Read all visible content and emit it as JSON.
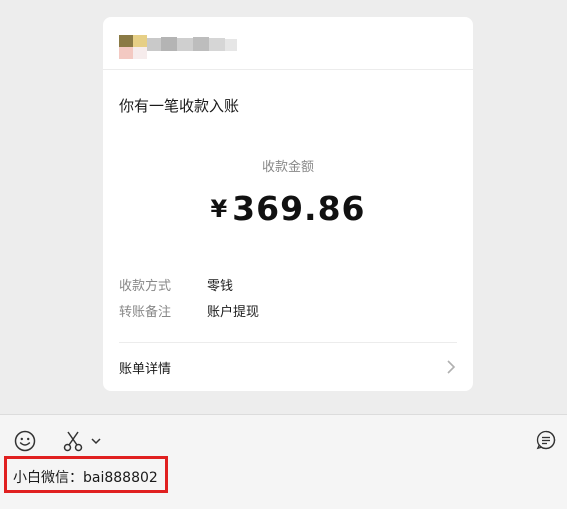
{
  "card": {
    "title": "你有一笔收款入账",
    "amount_label": "收款金额",
    "currency_symbol": "¥",
    "amount": "369.86",
    "fields": [
      {
        "key": "收款方式",
        "value": "零钱"
      },
      {
        "key": "转账备注",
        "value": "账户提现"
      }
    ],
    "detail_link": "账单详情"
  },
  "toolbar": {
    "emoji_icon": "emoji-icon",
    "screenshot_icon": "scissors-icon",
    "dropdown_icon": "chevron-down-icon",
    "history_icon": "chat-history-icon"
  },
  "composer": {
    "text": "小白微信：bai888802"
  },
  "colors": {
    "background": "#ededed",
    "card": "#ffffff",
    "highlight": "#e02020",
    "muted_text": "#888888"
  }
}
